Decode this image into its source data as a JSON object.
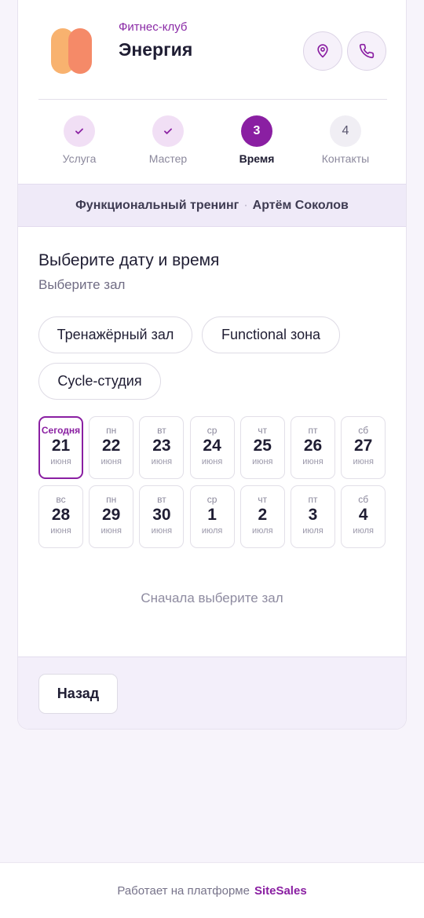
{
  "club": {
    "subtitle": "Фитнес-клуб",
    "name": "Энергия"
  },
  "header_icons": [
    "location-pin-icon",
    "phone-icon"
  ],
  "steps": [
    {
      "label": "Услуга",
      "state": "done",
      "mark": "✓"
    },
    {
      "label": "Мастер",
      "state": "done",
      "mark": "✓"
    },
    {
      "label": "Время",
      "state": "active",
      "mark": "3"
    },
    {
      "label": "Контакты",
      "state": "pending",
      "mark": "4"
    }
  ],
  "summary": {
    "service": "Функциональный тренинг",
    "separator": "·",
    "master": "Артём Соколов"
  },
  "main": {
    "title": "Выберите дату и время",
    "subtitle": "Выберите зал"
  },
  "halls": [
    "Тренажёрный зал",
    "Functional зона",
    "Cycle-студия"
  ],
  "days": [
    {
      "dow": "Сегодня",
      "num": "21",
      "mon": "июня",
      "today": true
    },
    {
      "dow": "пн",
      "num": "22",
      "mon": "июня"
    },
    {
      "dow": "вт",
      "num": "23",
      "mon": "июня"
    },
    {
      "dow": "ср",
      "num": "24",
      "mon": "июня"
    },
    {
      "dow": "чт",
      "num": "25",
      "mon": "июня"
    },
    {
      "dow": "пт",
      "num": "26",
      "mon": "июня"
    },
    {
      "dow": "сб",
      "num": "27",
      "mon": "июня"
    },
    {
      "dow": "вс",
      "num": "28",
      "mon": "июня"
    },
    {
      "dow": "пн",
      "num": "29",
      "mon": "июня"
    },
    {
      "dow": "вт",
      "num": "30",
      "mon": "июня"
    },
    {
      "dow": "ср",
      "num": "1",
      "mon": "июля"
    },
    {
      "dow": "чт",
      "num": "2",
      "mon": "июля"
    },
    {
      "dow": "пт",
      "num": "3",
      "mon": "июля"
    },
    {
      "dow": "сб",
      "num": "4",
      "mon": "июля"
    }
  ],
  "empty_hint": "Сначала выберите зал",
  "back_label": "Назад",
  "footer": {
    "text": "Работает на платформе",
    "brand": "SiteSales"
  },
  "colors": {
    "accent": "#8a1fa2",
    "background": "#f7f4fb"
  }
}
